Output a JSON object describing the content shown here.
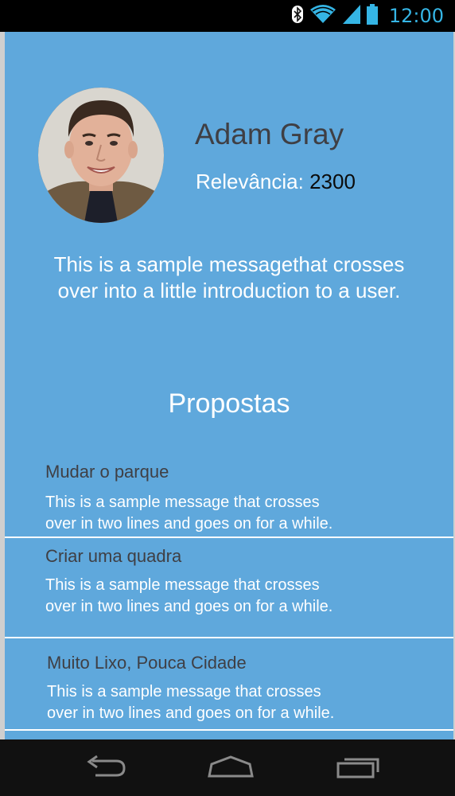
{
  "status_bar": {
    "time": "12:00",
    "icons": [
      "bluetooth-icon",
      "wifi-icon",
      "signal-icon",
      "battery-icon"
    ],
    "accent_color": "#35b5e5"
  },
  "profile": {
    "name": "Adam Gray",
    "relevance_label": "Relevância:",
    "relevance_value": "2300",
    "intro_line1": "This is a sample messagethat crosses",
    "intro_line2": "over into a little introduction to a user."
  },
  "proposals": {
    "title": "Propostas",
    "items": [
      {
        "title": "Mudar o parque",
        "body_line1": "This is a sample message that crosses",
        "body_line2": "over in two lines and goes on for a while."
      },
      {
        "title": "Criar uma quadra",
        "body_line1": "This is a sample message that crosses",
        "body_line2": "over in two lines and goes on for a while."
      },
      {
        "title": "Muito Lixo, Pouca Cidade",
        "body_line1": "This is a sample message that crosses",
        "body_line2": "over in two lines and goes on for a while."
      }
    ]
  },
  "nav_bar": {
    "buttons": [
      "back-icon",
      "home-icon",
      "recents-icon"
    ]
  },
  "colors": {
    "background": "#5fa8dc",
    "title_text": "#3f3f44",
    "body_text": "#ffffff"
  }
}
